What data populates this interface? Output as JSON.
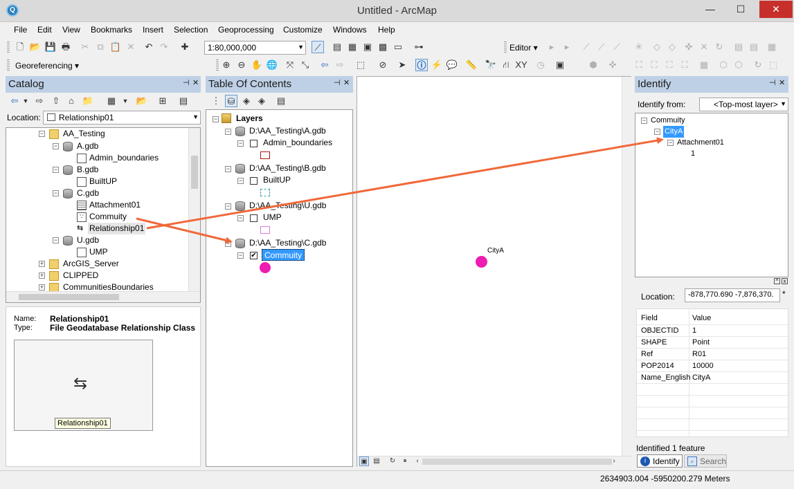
{
  "window": {
    "title": "Untitled - ArcMap",
    "minimize": "—",
    "maximize": "☐",
    "close": "✕"
  },
  "menu": [
    "File",
    "Edit",
    "View",
    "Bookmarks",
    "Insert",
    "Selection",
    "Geoprocessing",
    "Customize",
    "Windows",
    "Help"
  ],
  "toolbar": {
    "scale": "1:80,000,000",
    "editor_label": "Editor ▾",
    "georef_label": "Georeferencing ▾"
  },
  "catalog": {
    "title": "Catalog",
    "location_label": "Location:",
    "location_value": "Relationship01",
    "tree": [
      "AA_Testing",
      "A.gdb",
      "Admin_boundaries",
      "B.gdb",
      "BuiltUP",
      "C.gdb",
      "Attachment01",
      "Commuity",
      "Relationship01",
      "U.gdb",
      "UMP",
      "ArcGIS_Server",
      "CLIPPED",
      "CommunitiesBoundaries"
    ],
    "info_name_label": "Name:",
    "info_name": "Relationship01",
    "info_type_label": "Type:",
    "info_type": "File Geodatabase Relationship Class",
    "preview_caption": "Relationship01"
  },
  "toc": {
    "title": "Table Of Contents",
    "layers_label": "Layers",
    "groups": [
      {
        "path": "D:\\AA_Testing\\A.gdb",
        "layer": "Admin_boundaries"
      },
      {
        "path": "D:\\AA_Testing\\B.gdb",
        "layer": "BuiltUP"
      },
      {
        "path": "D:\\AA_Testing\\U.gdb",
        "layer": "UMP"
      },
      {
        "path": "D:\\AA_Testing\\C.gdb",
        "layer": "Commuity"
      }
    ],
    "checked": "✔"
  },
  "map": {
    "point_label": "CityA"
  },
  "identify": {
    "title": "Identify",
    "from_label": "Identify from:",
    "from_value": "<Top-most layer>",
    "tree": [
      "Commuity",
      "CityA",
      "Attachment01",
      "1"
    ],
    "location_label": "Location:",
    "location_value": "-878,770.690  -7,876,370.",
    "field_header": "Field",
    "value_header": "Value",
    "rows": [
      {
        "field": "OBJECTID",
        "value": "1"
      },
      {
        "field": "SHAPE",
        "value": "Point"
      },
      {
        "field": "Ref",
        "value": "R01"
      },
      {
        "field": "POP2014",
        "value": "10000"
      },
      {
        "field": "Name_English",
        "value": "CityA"
      }
    ],
    "status": "Identified 1 feature",
    "tab_identify": "Identify",
    "tab_search": "Search"
  },
  "statusbar": {
    "coords": "2634903.004  -5950200.279 Meters"
  },
  "colors": {
    "panel_header": "#bed0e6",
    "selection": "#3399ff",
    "point": "#ee1cb0",
    "arrow": "#f0683a"
  }
}
